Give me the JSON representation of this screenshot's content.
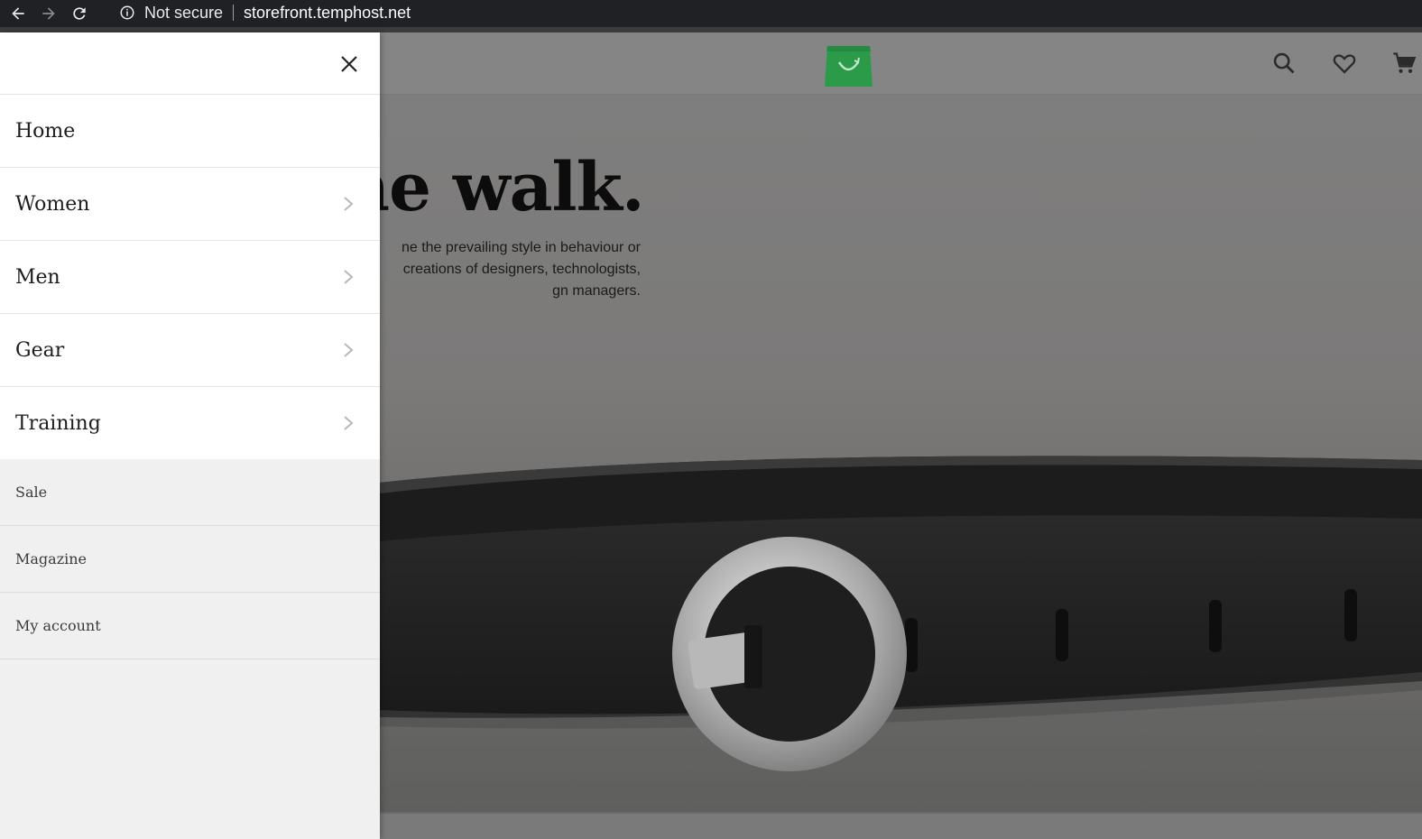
{
  "browser": {
    "security_label": "Not secure",
    "url": "storefront.temphost.net",
    "icons": [
      "back-arrow-icon",
      "forward-arrow-icon",
      "reload-icon",
      "info-icon"
    ]
  },
  "header": {
    "icons": [
      "shopping-bag-logo",
      "search-icon",
      "heart-icon",
      "cart-icon"
    ],
    "logo_color": "#2fa84f"
  },
  "hero": {
    "title_visible": "k the walk.",
    "text_lines": [
      "ne the prevailing style in behaviour or",
      "creations of designers, technologists,",
      "gn managers."
    ]
  },
  "drawer": {
    "primary_items": [
      {
        "label": "Home",
        "has_submenu": false
      },
      {
        "label": "Women",
        "has_submenu": true
      },
      {
        "label": "Men",
        "has_submenu": true
      },
      {
        "label": "Gear",
        "has_submenu": true
      },
      {
        "label": "Training",
        "has_submenu": true
      }
    ],
    "secondary_items": [
      {
        "label": "Sale"
      },
      {
        "label": "Magazine"
      },
      {
        "label": "My account"
      }
    ]
  }
}
